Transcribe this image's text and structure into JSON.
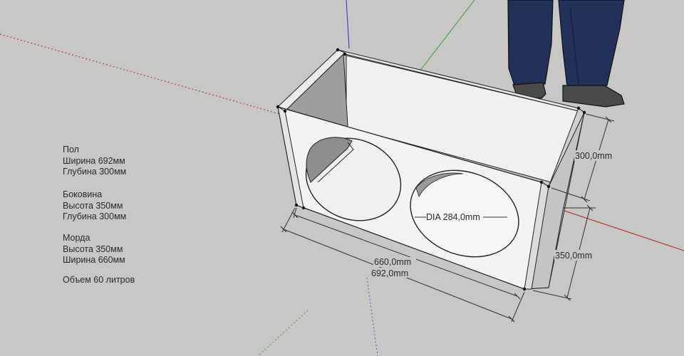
{
  "specs": {
    "floor": {
      "title": "Пол",
      "lines": [
        "Ширина 692мм",
        "Глубина 300мм"
      ]
    },
    "side": {
      "title": "Боковина",
      "lines": [
        "Высота 350мм",
        "Глубина 300мм"
      ]
    },
    "front": {
      "title": "Морда",
      "lines": [
        "Высота 350мм",
        "Ширина 660мм"
      ]
    },
    "volume": "Объем 60 литров"
  },
  "dimensions": {
    "depth": "300,0mm",
    "height": "350,0mm",
    "inner_width": "660,0mm",
    "outer_width": "692,0mm",
    "hole_diameter": "DIA 284,0mm"
  },
  "colors": {
    "background": "#c7c7c5",
    "panel_face": "#f2f2f2",
    "inner_shadow": "#9a9a9a",
    "axis_red": "#c22222",
    "axis_green": "#33a033",
    "axis_blue": "#2a2ad0",
    "jeans": "#22305a"
  }
}
